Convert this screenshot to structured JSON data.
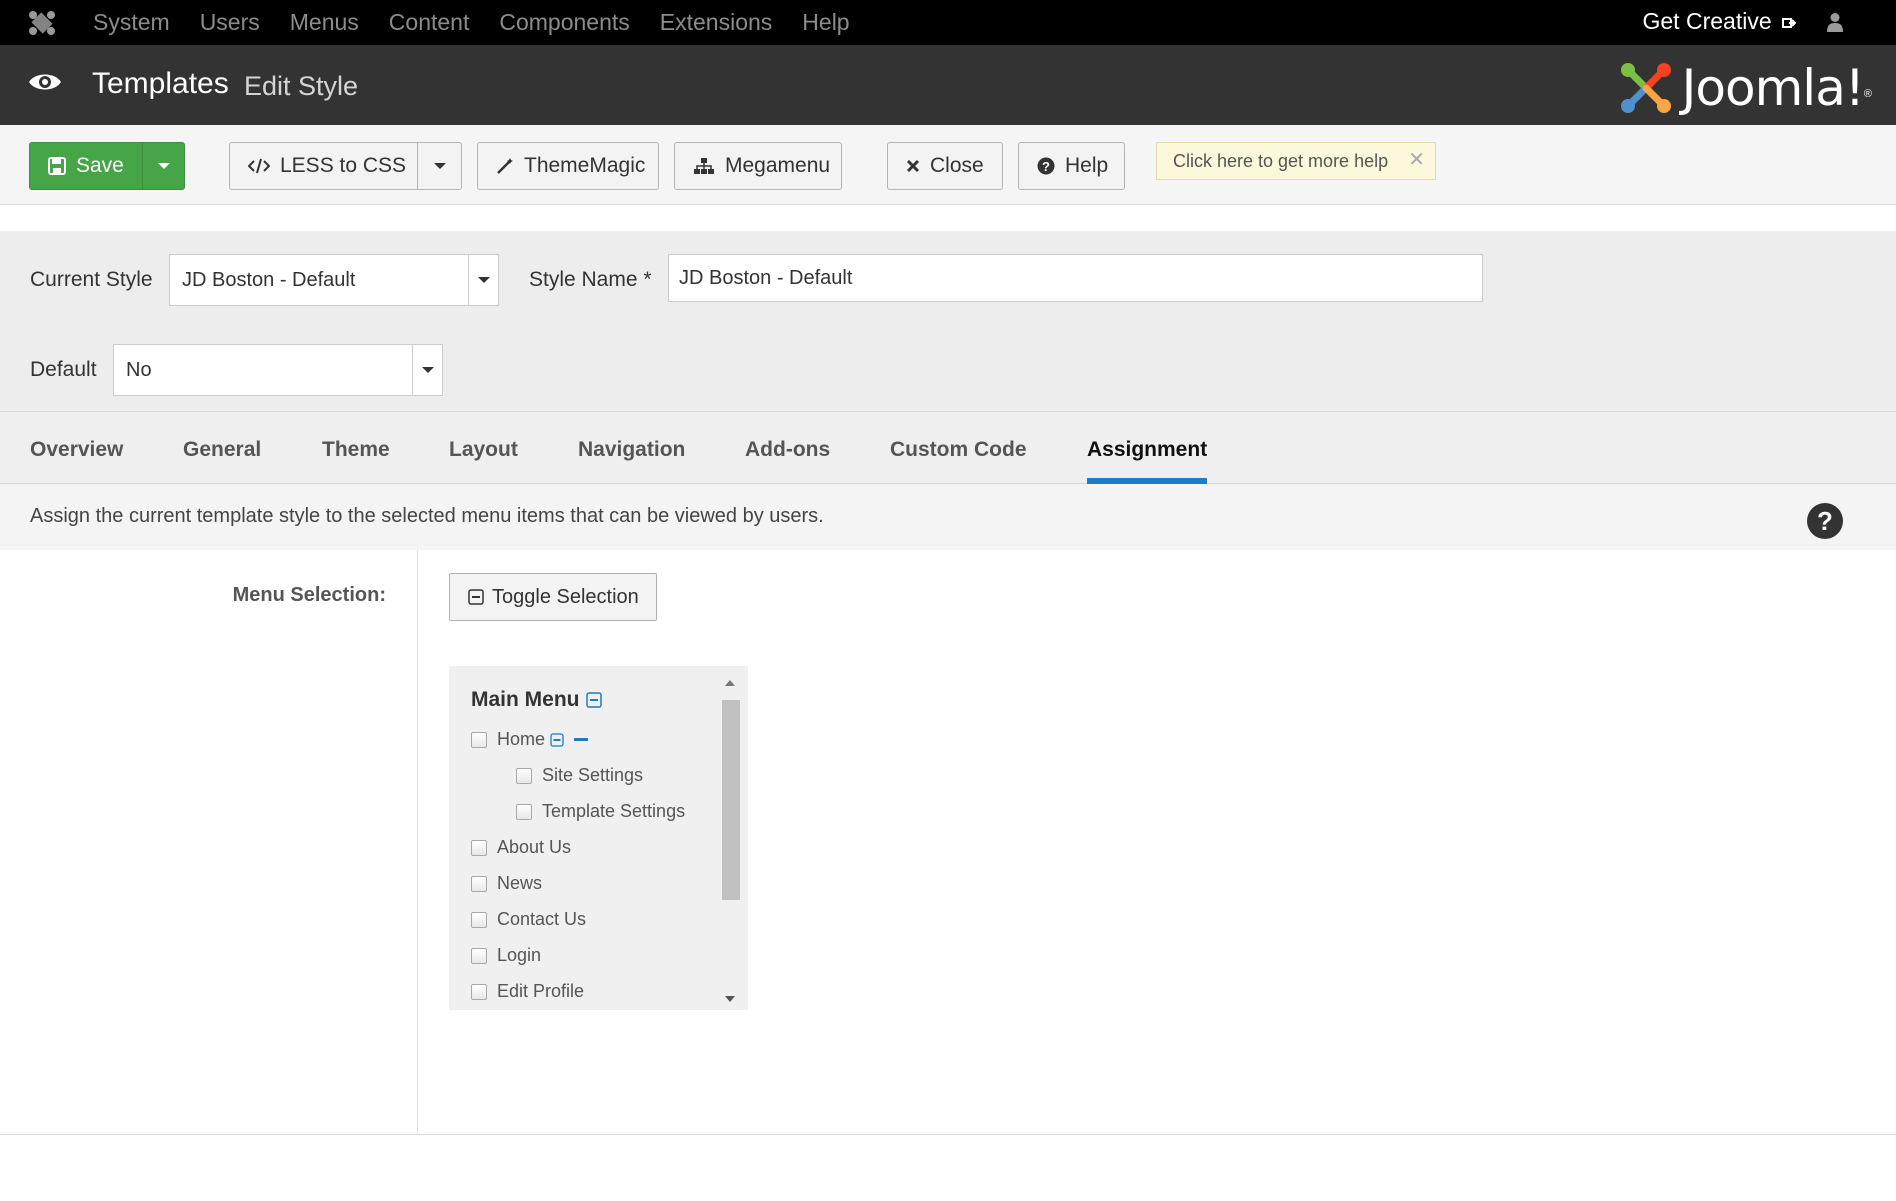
{
  "topnav": {
    "items": [
      "System",
      "Users",
      "Menus",
      "Content",
      "Components",
      "Extensions",
      "Help"
    ],
    "get_creative": "Get Creative"
  },
  "title": {
    "main": "Templates",
    "sub": "Edit Style",
    "brand": "Joomla!"
  },
  "toolbar": {
    "save": "Save",
    "less_to_css": "LESS to CSS",
    "thememagic": "ThemeMagic",
    "megamenu": "Megamenu",
    "close": "Close",
    "help": "Help",
    "tip": "Click here to get more help"
  },
  "form": {
    "current_style_label": "Current Style",
    "current_style_value": "JD Boston - Default",
    "style_name_label": "Style Name *",
    "style_name_value": "JD Boston - Default",
    "default_label": "Default",
    "default_value": "No"
  },
  "tabs": [
    "Overview",
    "General",
    "Theme",
    "Layout",
    "Navigation",
    "Add-ons",
    "Custom Code",
    "Assignment"
  ],
  "active_tab": "Assignment",
  "description": "Assign the current template style to the selected menu items that can be viewed by users.",
  "assignment": {
    "menu_selection_label": "Menu Selection:",
    "toggle_selection": "Toggle Selection",
    "menu_title": "Main Menu",
    "items": [
      {
        "label": "Home",
        "level": 1
      },
      {
        "label": "Site Settings",
        "level": 2
      },
      {
        "label": "Template Settings",
        "level": 2
      },
      {
        "label": "About Us",
        "level": 1
      },
      {
        "label": "News",
        "level": 1
      },
      {
        "label": "Contact Us",
        "level": 1
      },
      {
        "label": "Login",
        "level": 1
      },
      {
        "label": "Edit Profile",
        "level": 1
      }
    ]
  },
  "colors": {
    "save_green": "#46a546",
    "tab_accent": "#1e7bc4",
    "header_dark": "#333333"
  }
}
